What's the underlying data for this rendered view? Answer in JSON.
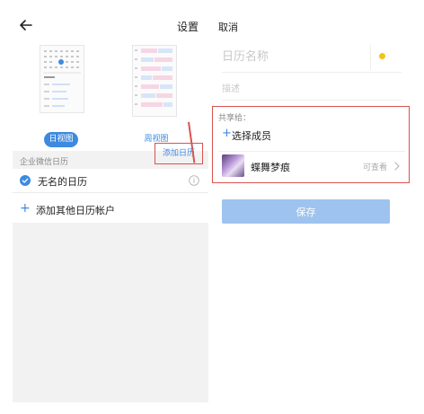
{
  "left_panel": {
    "header": {
      "settings_label": "设置"
    },
    "views": {
      "day_view_label": "日视图",
      "week_view_label": "周视图"
    },
    "section_label": "企业微信日历",
    "add_calendar_label": "添加日历",
    "calendar_item": {
      "name": "无名的日历"
    },
    "add_account_label": "添加其他日历帐户",
    "colors": {
      "accent": "#3d8ae0",
      "highlight_border": "#d9534f",
      "panel_bg": "#f2f2f2"
    }
  },
  "right_panel": {
    "cancel_label": "取消",
    "name_placeholder": "日历名称",
    "color_dot": "#f2c418",
    "desc_placeholder": "描述",
    "share_label": "共享给：",
    "select_member_label": "选择成员",
    "member": {
      "name": "蝶舞梦痕",
      "permission": "可查看"
    },
    "save_label": "保存",
    "save_color": "#9ec3ee"
  },
  "icons": [
    "back-arrow-icon",
    "check-circle-icon",
    "info-icon",
    "plus-icon",
    "chevron-right-icon"
  ]
}
